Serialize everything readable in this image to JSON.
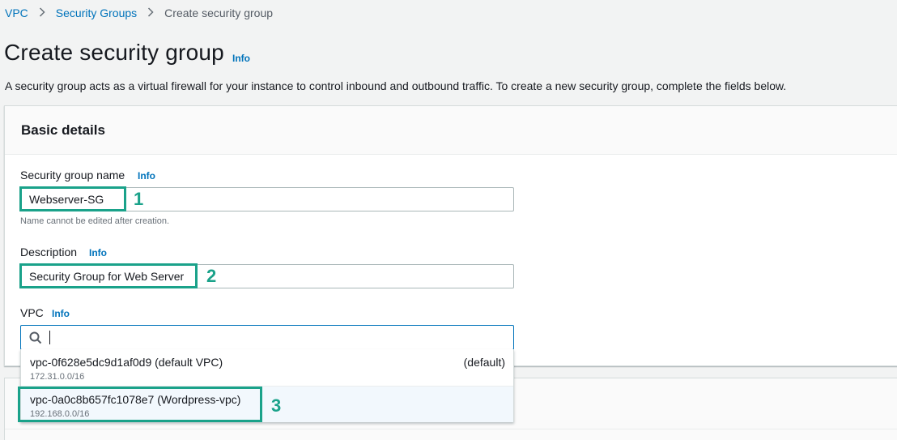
{
  "breadcrumb": {
    "items": [
      "VPC",
      "Security Groups"
    ],
    "current": "Create security group"
  },
  "page": {
    "title": "Create security group",
    "title_info": "Info",
    "description": "A security group acts as a virtual firewall for your instance to control inbound and outbound traffic. To create a new security group, complete the fields below."
  },
  "basic_details": {
    "heading": "Basic details",
    "name_field": {
      "label": "Security group name",
      "info": "Info",
      "value": "Webserver-SG",
      "hint": "Name cannot be edited after creation."
    },
    "description_field": {
      "label": "Description",
      "info": "Info",
      "value": "Security Group for Web Server"
    },
    "vpc_field": {
      "label": "VPC",
      "info": "Info",
      "search_value": "",
      "options": [
        {
          "name": "vpc-0f628e5dc9d1af0d9 (default VPC)",
          "cidr": "172.31.0.0/16",
          "tag": "(default)"
        },
        {
          "name": "vpc-0a0c8b657fc1078e7 (Wordpress-vpc)",
          "cidr": "192.168.0.0/16",
          "tag": ""
        }
      ]
    }
  },
  "annotations": [
    "1",
    "2",
    "3"
  ],
  "colors": {
    "link": "#0073bb",
    "highlight": "#1aa28a",
    "background": "#f2f3f3"
  }
}
